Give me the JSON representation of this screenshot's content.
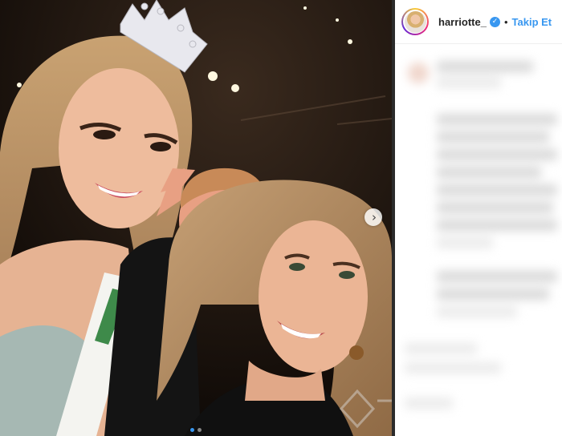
{
  "post": {
    "username": "harriotte_",
    "verified_glyph": "✓",
    "separator": "•",
    "follow_label": "Takip Et",
    "next_glyph": "›",
    "carousel_dots": 2,
    "active_dot": 0
  },
  "icons": {
    "verified": "verified-badge-icon",
    "next": "chevron-right-icon",
    "watermark": "watermark-logo"
  },
  "colors": {
    "accent": "#3897f0",
    "username": "#262626",
    "divider": "#2b2b2b"
  }
}
